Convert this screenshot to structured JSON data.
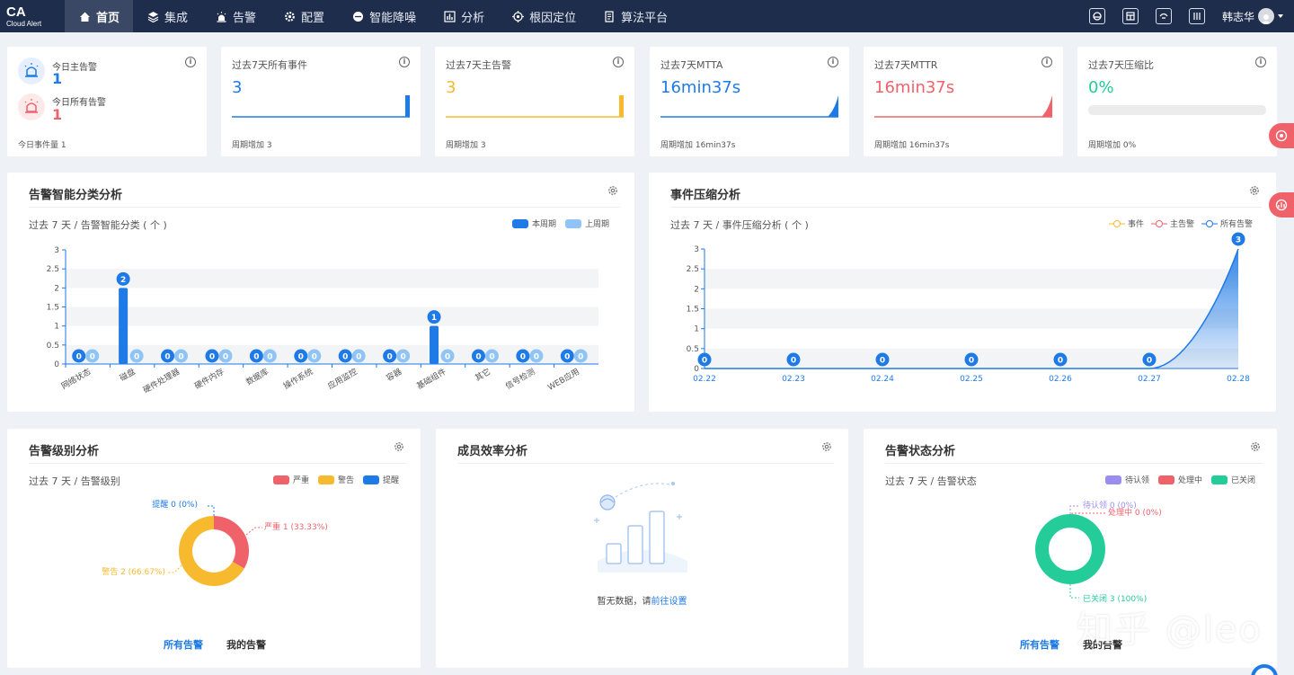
{
  "app": {
    "logo_title": "CA",
    "logo_subtitle": "Cloud Alert",
    "user_name": "韩志华"
  },
  "nav": [
    {
      "label": "首页",
      "icon": "home-icon",
      "active": true
    },
    {
      "label": "集成",
      "icon": "layers-icon"
    },
    {
      "label": "告警",
      "icon": "alarm-icon"
    },
    {
      "label": "配置",
      "icon": "gear-icon"
    },
    {
      "label": "智能降噪",
      "icon": "noise-icon"
    },
    {
      "label": "分析",
      "icon": "bar-chart-icon"
    },
    {
      "label": "根因定位",
      "icon": "target-icon"
    },
    {
      "label": "算法平台",
      "icon": "algorithm-icon"
    }
  ],
  "tools": [
    "monitor-icon",
    "dashboard-icon",
    "cloud-icon",
    "sliders-icon"
  ],
  "today": {
    "main_label": "今日主告警",
    "main_value": "1",
    "all_label": "今日所有告警",
    "all_value": "1",
    "foot": "今日事件量 1"
  },
  "stats": [
    {
      "title": "过去7天所有事件",
      "value": "3",
      "foot": "周期增加 3",
      "color": "#1e7ae6"
    },
    {
      "title": "过去7天主告警",
      "value": "3",
      "foot": "周期增加 3",
      "color": "#f7b92e"
    },
    {
      "title": "过去7天MTTA",
      "value": "16min37s",
      "foot": "周期增加 16min37s",
      "color": "#1e7ae6"
    },
    {
      "title": "过去7天MTTR",
      "value": "16min37s",
      "foot": "周期增加 16min37s",
      "color": "#f0626a"
    },
    {
      "title": "过去7天压缩比",
      "value": "0%",
      "foot": "周期增加 0%",
      "color": "#24cc9a"
    }
  ],
  "classify": {
    "title": "告警智能分类分析",
    "subtitle": "过去 7 天 / 告警智能分类 ( 个 )",
    "legend": [
      "本周期",
      "上周期"
    ]
  },
  "compress": {
    "title": "事件压缩分析",
    "subtitle": "过去 7 天 / 事件压缩分析 ( 个 )",
    "legend": [
      "事件",
      "主告警",
      "所有告警"
    ]
  },
  "level": {
    "title": "告警级别分析",
    "subtitle": "过去 7 天 / 告警级别",
    "legend": [
      "严重",
      "警告",
      "提醒"
    ],
    "labels": [
      "提醒 0 (0%)",
      "严重 1 (33.33%)",
      "警告 2 (66.67%)"
    ],
    "tabs": [
      "所有告警",
      "我的告警"
    ]
  },
  "member": {
    "title": "成员效率分析",
    "empty_text": "暂无数据，请",
    "empty_link": "前往设置"
  },
  "status": {
    "title": "告警状态分析",
    "subtitle": "过去 7 天 / 告警状态",
    "legend": [
      "待认领",
      "处理中",
      "已关闭"
    ],
    "labels": [
      "待认领 0 (0%)",
      "处理中 0 (0%)",
      "已关闭 3 (100%)"
    ],
    "tabs": [
      "所有告警",
      "我的告警"
    ]
  },
  "watermark": "知乎 @leo",
  "chart_data": [
    {
      "type": "bar",
      "categories": [
        "网络状态",
        "磁盘",
        "硬件处理器",
        "硬件内存",
        "数据库",
        "操作系统",
        "应用监控",
        "容器",
        "基础组件",
        "其它",
        "信号检测",
        "WEB应用"
      ],
      "series": [
        {
          "name": "本周期",
          "values": [
            0,
            2,
            0,
            0,
            0,
            0,
            0,
            0,
            1,
            0,
            0,
            0
          ]
        },
        {
          "name": "上周期",
          "values": [
            0,
            0,
            0,
            0,
            0,
            0,
            0,
            0,
            0,
            0,
            0,
            0
          ]
        }
      ],
      "yticks": [
        "0",
        "0.5",
        "1",
        "1.5",
        "2",
        "2.5",
        "3"
      ],
      "ylim": [
        0,
        3
      ]
    },
    {
      "type": "area",
      "x": [
        "02.22",
        "02.23",
        "02.24",
        "02.25",
        "02.26",
        "02.27",
        "02.28"
      ],
      "series": [
        {
          "name": "所有告警",
          "values": [
            0,
            0,
            0,
            0,
            0,
            0,
            3
          ]
        }
      ],
      "yticks": [
        "0",
        "0.5",
        "1",
        "1.5",
        "2",
        "2.5",
        "3"
      ],
      "ylim": [
        0,
        3
      ]
    },
    {
      "type": "pie",
      "categories": [
        "严重",
        "警告",
        "提醒"
      ],
      "values": [
        1,
        2,
        0
      ],
      "colors": [
        "#f0626a",
        "#f7b92e",
        "#1e7ae6"
      ]
    },
    {
      "type": "pie",
      "categories": [
        "待认领",
        "处理中",
        "已关闭"
      ],
      "values": [
        0,
        0,
        3
      ],
      "colors": [
        "#9b8cf0",
        "#f0626a",
        "#24cc9a"
      ]
    }
  ]
}
